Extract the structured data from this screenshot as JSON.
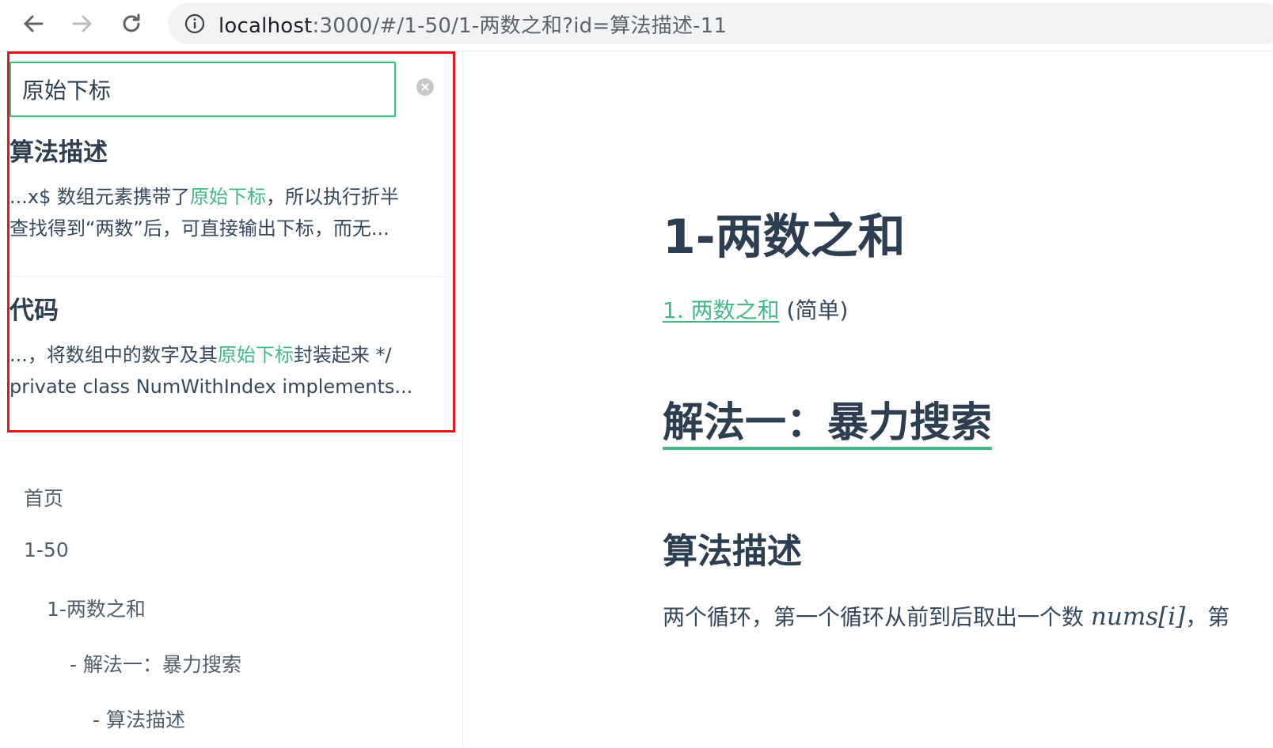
{
  "browser": {
    "url_host": "localhost",
    "url_rest": ":3000/#/1-50/1-两数之和?id=算法描述-11"
  },
  "search": {
    "value": "原始下标",
    "results": [
      {
        "title": "算法描述",
        "snippet_l1_pre": "...x$ 数组元素携带了",
        "snippet_l1_hl": "原始下标",
        "snippet_l1_post": "，所以执行折半",
        "snippet_l2": "查找得到“两数”后，可直接输出下标，而无..."
      },
      {
        "title": "代码",
        "snippet_l1_pre": "...，将数组中的数字及其",
        "snippet_l1_hl": "原始下标",
        "snippet_l1_post": "封装起来 */",
        "snippet_l2": "private class NumWithIndex implements..."
      }
    ]
  },
  "sidebar": {
    "items": [
      {
        "label": "首页"
      },
      {
        "label": "1-50"
      },
      {
        "label": "1-两数之和"
      },
      {
        "label": "- 解法一：暴力搜索"
      },
      {
        "label": "- 算法描述"
      }
    ]
  },
  "content": {
    "title": "1-两数之和",
    "problem_link": "1. 两数之和",
    "difficulty": "(简单)",
    "solution_heading": "解法一：暴力搜索",
    "algo_heading": "算法描述",
    "paragraph_pre": "两个循环，第一个循环从前到后取出一个数 ",
    "paragraph_math": "nums[i]",
    "paragraph_post": "，第"
  },
  "colors": {
    "accent": "#42b983",
    "highlight_box": "#e4161d",
    "text": "#2c3e50"
  },
  "icons": [
    "back-arrow-icon",
    "forward-arrow-icon",
    "reload-icon",
    "info-icon",
    "clear-icon"
  ]
}
